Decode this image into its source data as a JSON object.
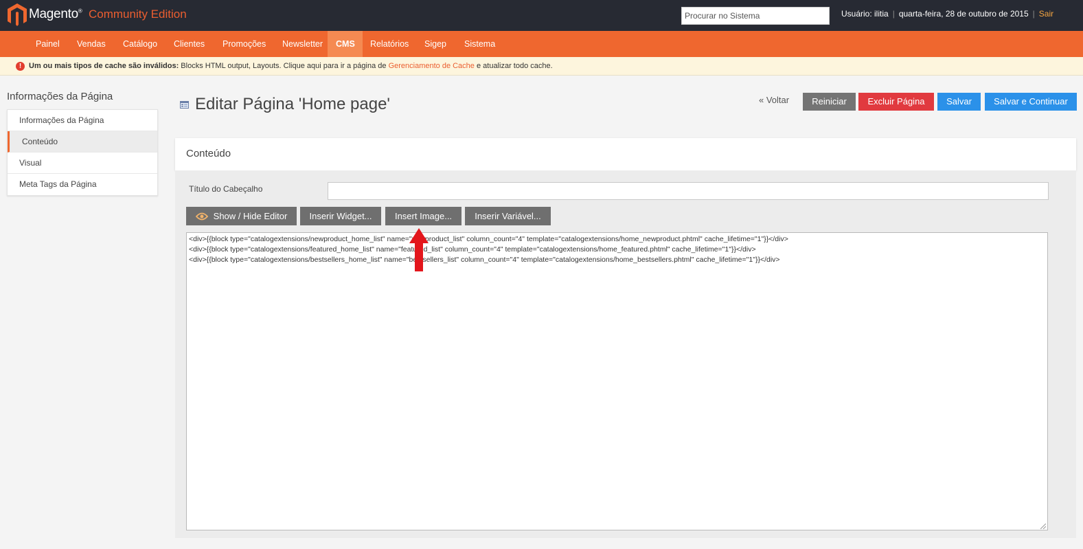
{
  "header": {
    "logo_word": "Magento",
    "edition": "Community Edition",
    "search_placeholder": "Procurar no Sistema",
    "user": "Usuário: ilitia",
    "date": "quarta-feira, 28 de outubro de 2015",
    "logout": "Sair"
  },
  "nav": {
    "items": [
      "Painel",
      "Vendas",
      "Catálogo",
      "Clientes",
      "Promoções",
      "Newsletter",
      "CMS",
      "Relatórios",
      "Sigep",
      "Sistema"
    ],
    "active": "CMS"
  },
  "notice": {
    "bold": "Um ou mais tipos de cache são inválidos:",
    "text": " Blocks HTML output, Layouts. Clique aqui para ir a página de ",
    "link": "Gerenciamento de Cache",
    "tail": " e atualizar todo cache."
  },
  "sidebar": {
    "title": "Informações da Página",
    "items": [
      "Informações da Página",
      "Conteúdo",
      "Visual",
      "Meta Tags da Página"
    ],
    "active": "Conteúdo"
  },
  "page": {
    "title": "Editar Página 'Home page'",
    "back": "« Voltar",
    "reset": "Reiniciar",
    "delete": "Excluir Página",
    "save": "Salvar",
    "save_continue": "Salvar e Continuar"
  },
  "content": {
    "section_title": "Conteúdo",
    "heading_label": "Título do Cabeçalho",
    "heading_value": "",
    "toolbar": {
      "show_hide": "Show / Hide Editor",
      "widget": "Inserir Widget...",
      "image": "Insert Image...",
      "variable": "Inserir Variável..."
    },
    "editor_lines": [
      "<div>{{block type=\"catalogextensions/newproduct_home_list\" name=\"newproduct_list\" column_count=\"4\" template=\"catalogextensions/home_newproduct.phtml\" cache_lifetime=\"1\"}}</div>",
      "<div>{{block type=\"catalogextensions/featured_home_list\" name=\"featured_list\" column_count=\"4\" template=\"catalogextensions/home_featured.phtml\" cache_lifetime=\"1\"}}</div>",
      "<div>{{block type=\"catalogextensions/bestsellers_home_list\" name=\"bestsellers_list\" column_count=\"4\" template=\"catalogextensions/home_bestsellers.phtml\" cache_lifetime=\"1\"}}</div>"
    ]
  },
  "colors": {
    "header_bg": "#272a33",
    "accent": "#ef672f",
    "danger": "#e13a3f",
    "primary": "#2b91e9",
    "neutral_button": "#747474"
  }
}
